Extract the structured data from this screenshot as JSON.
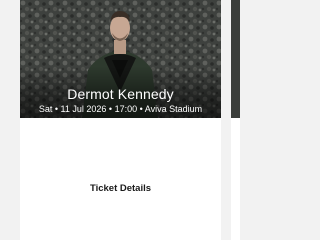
{
  "event": {
    "artist": "Dermot Kennedy",
    "day": "Sat",
    "date": "11 Jul 2026",
    "time": "17:00",
    "venue": "Aviva Stadium",
    "separator": "•"
  },
  "ticket": {
    "details_label": "Ticket Details"
  },
  "colors": {
    "page_background": "#f2f2f2",
    "card_background": "#ffffff",
    "hero_text": "#ffffff",
    "button_text": "#1a1a1a"
  }
}
